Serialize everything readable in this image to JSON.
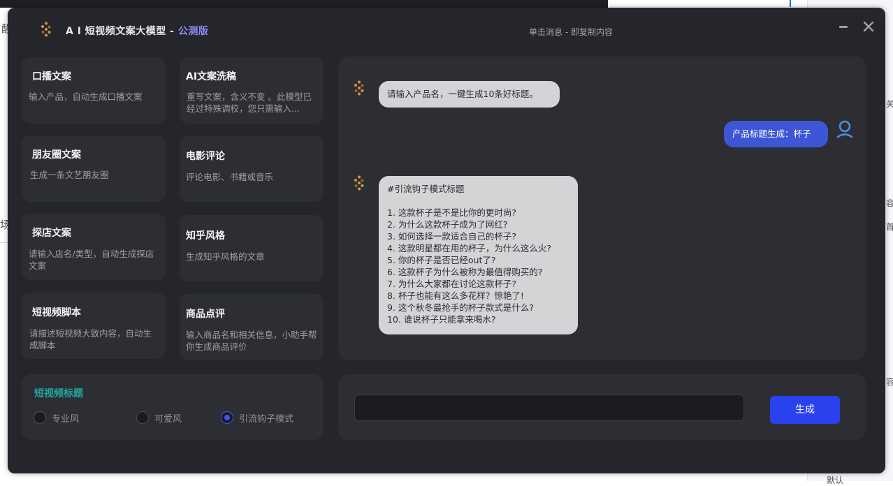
{
  "app": {
    "title": "A I 短视频文案大模型 - ",
    "beta_label": "公测版",
    "hint": "单击消息 - 即复制内容"
  },
  "background": {
    "frag_1": "醒",
    "frag_2": "场",
    "frag_3": "关",
    "frag_4": "容",
    "frag_5": "首",
    "frag_6": "默认"
  },
  "templates": [
    {
      "title": "口播文案",
      "desc": "输入产品，自动生成口播文案"
    },
    {
      "title": "AI文案洗稿",
      "desc": "重写文案，含义不变 。此模型已经过特殊调校，您只需输入..."
    },
    {
      "title": "朋友圈文案",
      "desc": "生成一条文艺朋友圈"
    },
    {
      "title": "电影评论",
      "desc": "评论电影、书籍或音乐"
    },
    {
      "title": "探店文案",
      "desc": "请输入店名/类型，自动生成探店文案"
    },
    {
      "title": "知乎风格",
      "desc": "生成知乎风格的文章"
    },
    {
      "title": "短视频脚本",
      "desc": "请描述短视频大致内容，自动生成脚本"
    },
    {
      "title": "商品点评",
      "desc": "输入商品名和相关信息，小助手帮你生成商品评价"
    }
  ],
  "options": {
    "title": "短视频标题",
    "choices": [
      "专业风",
      "可爱风",
      "引流钩子模式"
    ],
    "selected": "引流钩子模式"
  },
  "chat": {
    "bot_greeting": "请输入产品名，一键生成10条好标题。",
    "user_message": "产品标题生成：杯子",
    "bot_reply": [
      "#引流钩子模式标题",
      "",
      "1. 这款杯子是不是比你的更时尚?",
      "2. 为什么这款杯子成为了网红?",
      "3. 如何选择一款适合自己的杯子?",
      "4. 这款明星都在用的杯子，为什么这么火?",
      "5. 你的杯子是否已经out了?",
      "6. 这款杯子为什么被称为最值得购买的?",
      "7. 为什么大家都在讨论这款杯子?",
      "8. 杯子也能有这么多花样？惊艳了!",
      "9. 这个秋冬最抢手的杯子款式是什么?",
      "10. 谁说杯子只能拿来喝水?"
    ]
  },
  "input": {
    "value": "",
    "generate_label": "生成"
  },
  "colors": {
    "accent": "#2a41ee",
    "beta": "#8e8cf5",
    "option_title": "#23a7a4",
    "logo_orange": "#d8953a"
  },
  "icons": {
    "logo": "spark-logo-icon",
    "minimize": "minimize-icon",
    "close": "close-icon",
    "user": "user-avatar-icon"
  }
}
